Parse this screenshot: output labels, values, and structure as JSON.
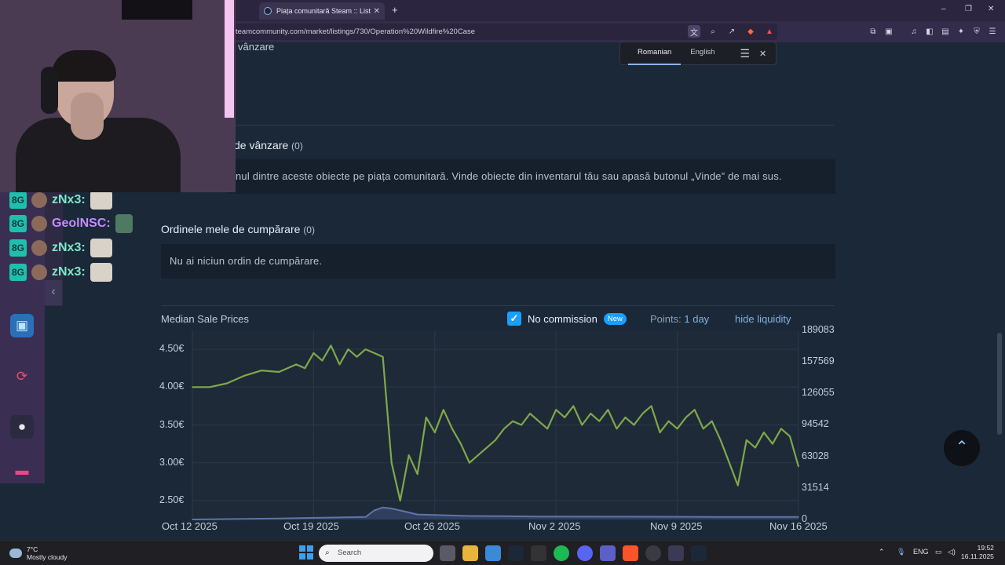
{
  "browser": {
    "tab_title": "Piața comunitară Steam :: Listări",
    "new_tab": "+",
    "url": "teamcommunity.com/market/listings/730/Operation%20Wildfire%20Case",
    "window_controls": [
      "–",
      "❐",
      "✕"
    ]
  },
  "translate": {
    "languages": [
      "Romanian",
      "English"
    ],
    "selected": "Romanian"
  },
  "chat": {
    "lines": [
      {
        "user": "zNx3:",
        "color": "#7ee8c8"
      },
      {
        "user": "GeolNSC:",
        "color": "#c38cff"
      },
      {
        "user": "zNx3:",
        "color": "#7ee8c8"
      },
      {
        "user": "zNx3:",
        "color": "#7ee8c8"
      }
    ]
  },
  "market": {
    "sell_heading_fragment": "vânzare",
    "listings_heading": "de vânzare",
    "listings_count": "(0)",
    "listings_empty": "nul dintre aceste obiecte pe piața comunitară. Vinde obiecte din inventarul tău sau apasă butonul „Vinde” de mai sus.",
    "buy_orders_heading": "Ordinele mele de cumpărare",
    "buy_orders_count": "(0)",
    "buy_orders_empty": "Nu ai niciun ordin de cumpărare."
  },
  "chart_controls": {
    "title": "Median Sale Prices",
    "no_commission": "No commission",
    "new_badge": "New",
    "points_label": "Points:",
    "points_value": "1 day",
    "hide_liquidity": "hide liquidity"
  },
  "chart_data": {
    "type": "line",
    "title": "Median Sale Prices",
    "y_left_ticks": [
      "4.50€",
      "4.00€",
      "3.50€",
      "3.00€",
      "2.50€"
    ],
    "y_right_ticks": [
      "189083",
      "157569",
      "126055",
      "94542",
      "63028",
      "31514",
      "0"
    ],
    "x_ticks": [
      "Oct 12 2025",
      "Oct 19 2025",
      "Oct 26 2025",
      "Nov 2 2025",
      "Nov 9 2025",
      "Nov 16 2025"
    ],
    "ylim_left": [
      2.25,
      4.75
    ],
    "ylim_right": [
      0,
      189083
    ],
    "x_days": [
      0,
      35
    ],
    "series": [
      {
        "color": "#7fa84a",
        "x": [
          0,
          1,
          2,
          3,
          4,
          5,
          6,
          6.5,
          7,
          7.5,
          8,
          8.5,
          9,
          9.5,
          10,
          10.5,
          11,
          11.5,
          12,
          12.5,
          13,
          13.5,
          14,
          14.5,
          15,
          15.5,
          16,
          16.5,
          17,
          17.5,
          18,
          18.5,
          19,
          19.5,
          20,
          20.5,
          21,
          21.5,
          22,
          22.5,
          23,
          23.5,
          24,
          24.5,
          25,
          25.5,
          26,
          26.5,
          27,
          27.5,
          28,
          28.5,
          29,
          29.5,
          30,
          30.5,
          31,
          31.5,
          32,
          32.5,
          33,
          33.5,
          34,
          34.5,
          35
        ],
        "y": [
          4.0,
          4.0,
          4.05,
          4.15,
          4.22,
          4.2,
          4.3,
          4.25,
          4.45,
          4.35,
          4.55,
          4.3,
          4.5,
          4.4,
          4.5,
          4.45,
          4.4,
          3.0,
          2.5,
          3.1,
          2.85,
          3.6,
          3.4,
          3.7,
          3.45,
          3.25,
          3.0,
          3.1,
          3.2,
          3.3,
          3.45,
          3.55,
          3.5,
          3.65,
          3.55,
          3.45,
          3.7,
          3.6,
          3.75,
          3.5,
          3.65,
          3.55,
          3.7,
          3.45,
          3.6,
          3.5,
          3.65,
          3.75,
          3.4,
          3.55,
          3.45,
          3.6,
          3.7,
          3.45,
          3.55,
          3.3,
          3.0,
          2.7,
          3.3,
          3.2,
          3.4,
          3.25,
          3.45,
          3.35,
          2.95
        ]
      },
      {
        "color": "#5f74a8",
        "axis": "right",
        "x": [
          0,
          5,
          10,
          10.5,
          11,
          11.5,
          12,
          13,
          16,
          20,
          25,
          30,
          35
        ],
        "y": [
          0,
          1000,
          2500,
          9000,
          12000,
          11000,
          9000,
          5000,
          3500,
          3000,
          2800,
          2600,
          2500
        ]
      }
    ]
  },
  "taskbar": {
    "temperature": "7°C",
    "weather": "Mostly cloudy",
    "search_placeholder": "Search",
    "language": "ENG",
    "time": "19:52",
    "date": "16.11.2025"
  },
  "colors": {
    "page_bg": "#1b2838",
    "accent": "#1a9fff",
    "line": "#7fa84a"
  }
}
